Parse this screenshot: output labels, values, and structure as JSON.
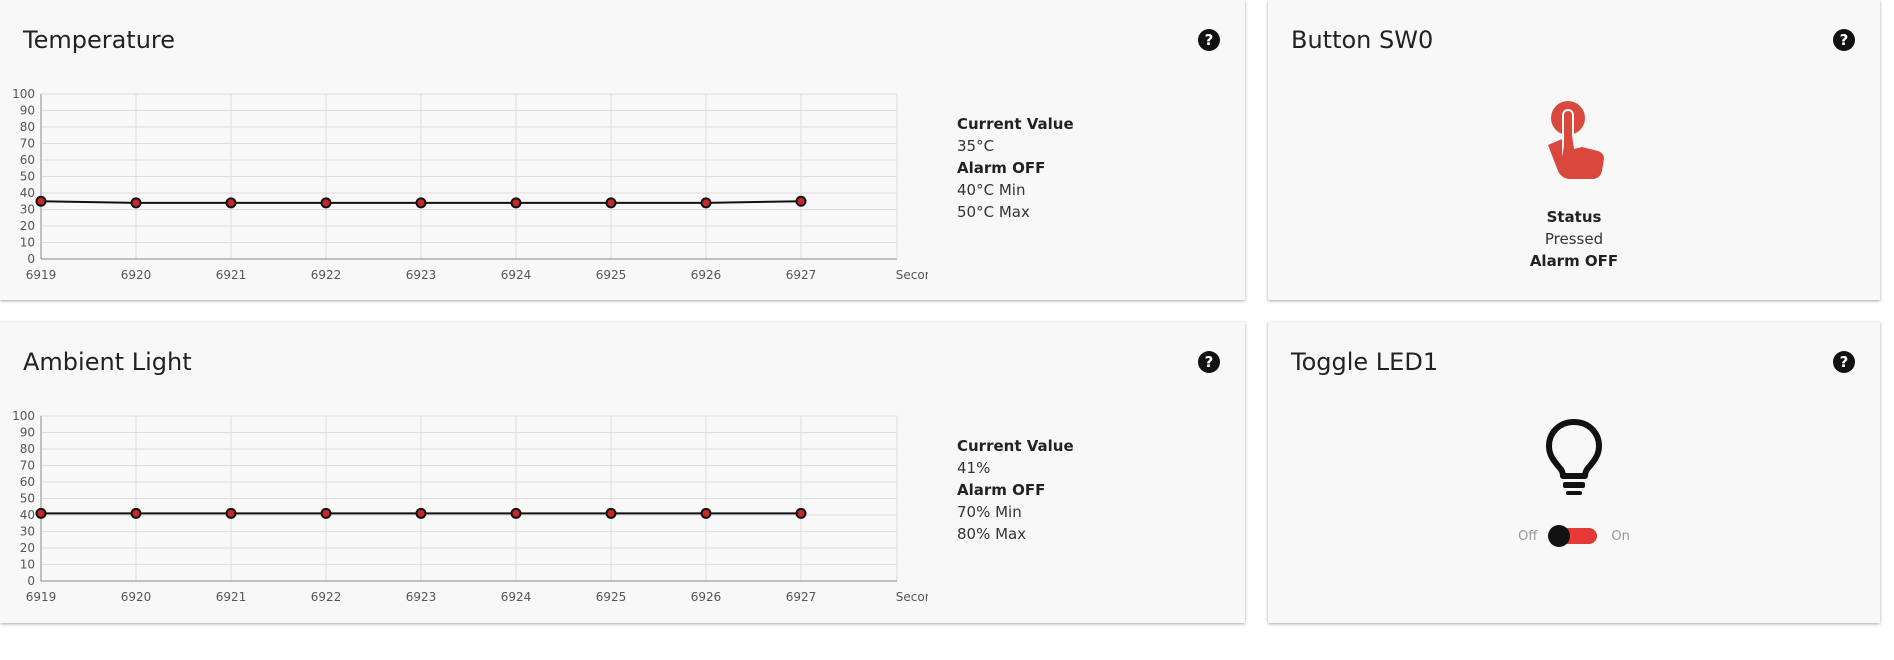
{
  "temperature": {
    "title": "Temperature",
    "current_label": "Current Value",
    "current_value": "35°C",
    "alarm": "Alarm OFF",
    "min": "40°C Min",
    "max": "50°C Max"
  },
  "ambient": {
    "title": "Ambient Light",
    "current_label": "Current Value",
    "current_value": "41%",
    "alarm": "Alarm OFF",
    "min": "70% Min",
    "max": "80% Max"
  },
  "button": {
    "title": "Button SW0",
    "status_label": "Status",
    "status_value": "Pressed",
    "alarm": "Alarm OFF",
    "icon_color": "#d9473d"
  },
  "led": {
    "title": "Toggle LED1",
    "off_label": "Off",
    "on_label": "On",
    "state": "on",
    "accent": "#e53935"
  },
  "chart_data": [
    {
      "type": "line",
      "x": [
        "6919",
        "6920",
        "6921",
        "6922",
        "6923",
        "6924",
        "6925",
        "6926",
        "6927"
      ],
      "series": [
        {
          "values": [
            35,
            34,
            34,
            34,
            34,
            34,
            34,
            34,
            35
          ]
        }
      ],
      "xlabel": "Seconds",
      "ylim": [
        0,
        100
      ],
      "yticks": [
        0,
        10,
        20,
        30,
        40,
        50,
        60,
        70,
        80,
        90,
        100
      ],
      "grid": true
    },
    {
      "type": "line",
      "x": [
        "6919",
        "6920",
        "6921",
        "6922",
        "6923",
        "6924",
        "6925",
        "6926",
        "6927"
      ],
      "series": [
        {
          "values": [
            41,
            41,
            41,
            41,
            41,
            41,
            41,
            41,
            41
          ]
        }
      ],
      "xlabel": "Seconds",
      "ylim": [
        0,
        100
      ],
      "yticks": [
        0,
        10,
        20,
        30,
        40,
        50,
        60,
        70,
        80,
        90,
        100
      ],
      "grid": true
    }
  ]
}
